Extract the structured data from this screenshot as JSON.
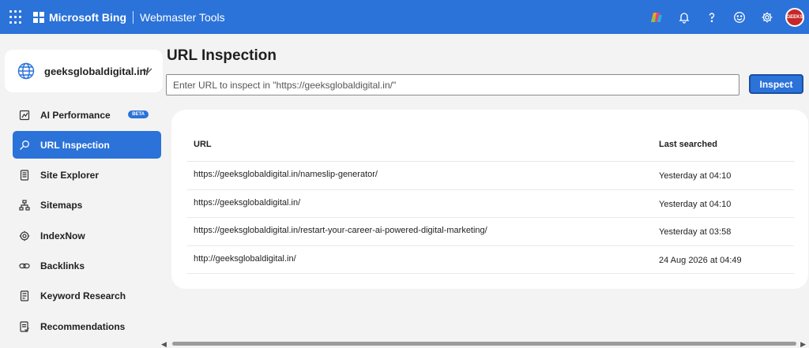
{
  "header": {
    "brand": "Microsoft Bing",
    "product": "Webmaster Tools",
    "avatar_text": "GEEKS",
    "colors": {
      "bar": "#2b72d9"
    },
    "icons": [
      "app-launcher-icon",
      "copilot-icon",
      "bell-icon",
      "help-icon",
      "feedback-smiley-icon",
      "gear-icon"
    ]
  },
  "sidebar": {
    "site": "geeksglobaldigital.in/",
    "items": [
      {
        "label": "AI Performance",
        "badge": "BETA",
        "icon": "chart-icon",
        "active": false
      },
      {
        "label": "URL Inspection",
        "icon": "search-icon",
        "active": true
      },
      {
        "label": "Site Explorer",
        "icon": "document-icon",
        "active": false
      },
      {
        "label": "Sitemaps",
        "icon": "sitemap-icon",
        "active": false
      },
      {
        "label": "IndexNow",
        "icon": "gear-icon",
        "active": false
      },
      {
        "label": "Backlinks",
        "icon": "link-icon",
        "active": false
      },
      {
        "label": "Keyword Research",
        "icon": "keyword-icon",
        "active": false
      },
      {
        "label": "Recommendations",
        "icon": "checklist-icon",
        "active": false
      }
    ]
  },
  "main": {
    "title": "URL Inspection",
    "input_placeholder": "Enter URL to inspect in \"https://geeksglobaldigital.in/\"",
    "inspect_label": "Inspect",
    "table": {
      "headers": [
        "URL",
        "Last searched"
      ],
      "rows": [
        {
          "url": "https://geeksglobaldigital.in/nameslip-generator/",
          "time": "Yesterday at 04:10"
        },
        {
          "url": "https://geeksglobaldigital.in/",
          "time": "Yesterday at 04:10"
        },
        {
          "url": "https://geeksglobaldigital.in/restart-your-career-ai-powered-digital-marketing/",
          "time": "Yesterday at 03:58"
        },
        {
          "url": "http://geeksglobaldigital.in/",
          "time": "24 Aug 2026 at 04:49"
        }
      ]
    }
  }
}
